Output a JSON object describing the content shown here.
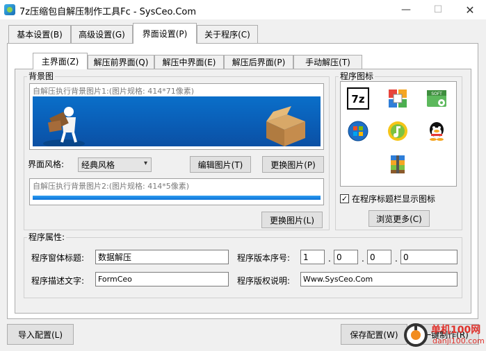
{
  "window": {
    "title": "7z压缩包自解压制作工具Fc - SysCeo.Com",
    "min_glyph": "—",
    "max_glyph": "☐",
    "close_glyph": "✕"
  },
  "main_tabs": [
    {
      "label": "基本设置(B)"
    },
    {
      "label": "高级设置(G)"
    },
    {
      "label": "界面设置(P)",
      "active": true
    },
    {
      "label": "关于程序(C)"
    }
  ],
  "sub_tabs": [
    {
      "label": "主界面(Z)",
      "active": true
    },
    {
      "label": "解压前界面(Q)"
    },
    {
      "label": "解压中界面(E)"
    },
    {
      "label": "解压后界面(P)"
    },
    {
      "label": "手动解压(T)"
    }
  ],
  "background": {
    "group_label": "背景图",
    "image1_caption": "自解压执行背景图片1:(图片规格: 414*71像素)",
    "image2_caption": "自解压执行背景图片2:(图片规格: 414*5像素)",
    "style_label": "界面风格:",
    "style_value": "经典风格",
    "edit_image_button": "编辑图片(T)",
    "change_image_button_1": "更换图片(P)",
    "change_image_button_2": "更换图片(L)"
  },
  "program_icon": {
    "group_label": "程序图标",
    "icons": [
      "7z-icon",
      "office-icon",
      "soft-setup-icon",
      "windows-orb-icon",
      "green-disc-icon",
      "qq-penguin-icon",
      "winrar-archive-icon"
    ],
    "seven_z_text": "7z",
    "soft_text": "SOFT",
    "show_in_titlebar_label": "在程序标题栏显示图标",
    "show_in_titlebar_checked": true,
    "check_glyph": "✓",
    "browse_more_button": "浏览更多(C)"
  },
  "properties": {
    "group_label": "程序属性:",
    "window_title_label": "程序窗体标题:",
    "window_title_value": "数据解压",
    "version_label": "程序版本序号:",
    "version_parts": [
      "1",
      "0",
      "0",
      "0"
    ],
    "version_separator": ".",
    "description_label": "程序描述文字:",
    "description_value": "FormCeo",
    "copyright_label": "程序版权说明:",
    "copyright_value": "Www.SysCeo.Com"
  },
  "bottom": {
    "import_button": "导入配置(L)",
    "save_button": "保存配置(W)",
    "make_button": "一键制作(R)"
  },
  "watermark": {
    "site_name": "单机100网",
    "site_url": "danji100.com"
  },
  "colors": {
    "banner_blue": "#0a5fb8",
    "progress_blue": "#1e88e5",
    "watermark_red": "#e0312b"
  }
}
